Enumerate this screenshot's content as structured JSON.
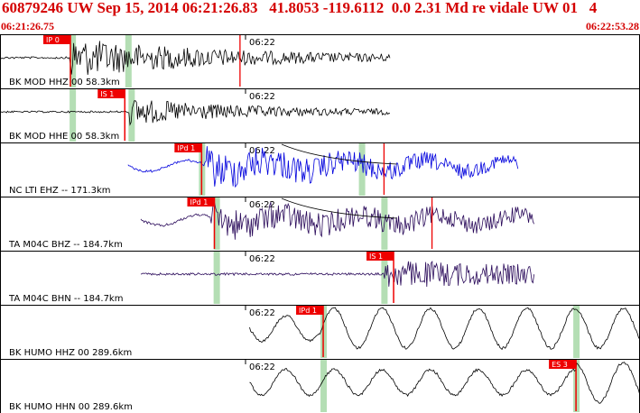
{
  "header": {
    "title": "60879246 UW Sep 15, 2014 06:21:26.83   41.8053 -119.6112  0.0 2.31 Md re vidale UW 01   4",
    "start_time": "06:21:26.75",
    "end_time": "06:22:53.28"
  },
  "colors": {
    "header_text": "#d40000",
    "pick_flag": "#ee0000",
    "window_band": "#b4deb4",
    "trace_black": "#000000",
    "trace_blue": "#0000dd",
    "trace_navy": "#2a0a5a"
  },
  "panels": [
    {
      "station_label": "BK MOD HHZ 00 58.3km",
      "time_mark": "06:22",
      "trace_color": "black",
      "picks": [
        {
          "label": "IP 0",
          "pos": 0.11
        }
      ],
      "extra_picks": [
        0.375
      ],
      "band_positions": [
        0.113,
        0.2
      ],
      "trace_start": 0,
      "trace_end": 0.61,
      "onset": 0.11,
      "amp": 26,
      "rand": 0.4,
      "decay": 0.25,
      "curve": false
    },
    {
      "station_label": "BK MOD HHE 00 58.3km",
      "time_mark": "06:22",
      "trace_color": "black",
      "picks": [
        {
          "label": "IS 1",
          "pos": 0.195
        }
      ],
      "extra_picks": [],
      "band_positions": [
        0.113,
        0.205
      ],
      "trace_start": 0,
      "trace_end": 0.61,
      "onset": 0.2,
      "amp": 20,
      "rand": 0.3,
      "decay": 0.2,
      "curve": false
    },
    {
      "station_label": "NC LTI EHZ -- 171.3km",
      "time_mark": "06:22",
      "trace_color": "blue",
      "picks": [
        {
          "label": "IPd 1",
          "pos": 0.315
        }
      ],
      "extra_picks": [
        0.6
      ],
      "band_positions": [
        0.315,
        0.565
      ],
      "trace_start": 0.2,
      "trace_end": 0.81,
      "onset": 0.32,
      "amp": 20,
      "rand": 0.6,
      "decay": 0.35,
      "curve": true
    },
    {
      "station_label": "TA M04C BHZ -- 184.7km",
      "time_mark": "06:22",
      "trace_color": "navy",
      "picks": [
        {
          "label": "IPd 1",
          "pos": 0.335
        }
      ],
      "extra_picks": [
        0.675
      ],
      "band_positions": [
        0.338,
        0.6
      ],
      "trace_start": 0.22,
      "trace_end": 0.835,
      "onset": 0.33,
      "amp": 14,
      "rand": 0.7,
      "decay": 0.6,
      "curve": true
    },
    {
      "station_label": "TA M04C BHN -- 184.7km",
      "time_mark": "06:22",
      "trace_color": "navy",
      "picks": [
        {
          "label": "IS 1",
          "pos": 0.615
        }
      ],
      "extra_picks": [],
      "band_positions": [
        0.338,
        0.6
      ],
      "trace_start": 0.22,
      "trace_end": 0.835,
      "onset": 0.6,
      "amp": 16,
      "rand": 0.5,
      "decay": 0.5,
      "curve": false
    },
    {
      "station_label": "BK HUMO HHZ 00 289.6km",
      "time_mark": "06:22",
      "trace_color": "black",
      "picks": [
        {
          "label": "IPd 1",
          "pos": 0.505
        }
      ],
      "extra_picks": [],
      "band_positions": [
        0.505,
        0.9
      ],
      "trace_start": 0.39,
      "trace_end": 1.0,
      "onset": 0.5,
      "amp": 20,
      "rand": 0.1,
      "decay": 0,
      "curve": false
    },
    {
      "station_label": "BK HUMO HHN 00 289.6km",
      "time_mark": "06:22",
      "trace_color": "black",
      "picks": [
        {
          "label": "ES 3",
          "pos": 0.9
        }
      ],
      "extra_picks": [],
      "band_positions": [
        0.505,
        0.9
      ],
      "trace_start": 0.39,
      "trace_end": 1.0,
      "onset": 0.9,
      "amp": 20,
      "rand": 0.15,
      "decay": 0,
      "curve": false
    }
  ]
}
